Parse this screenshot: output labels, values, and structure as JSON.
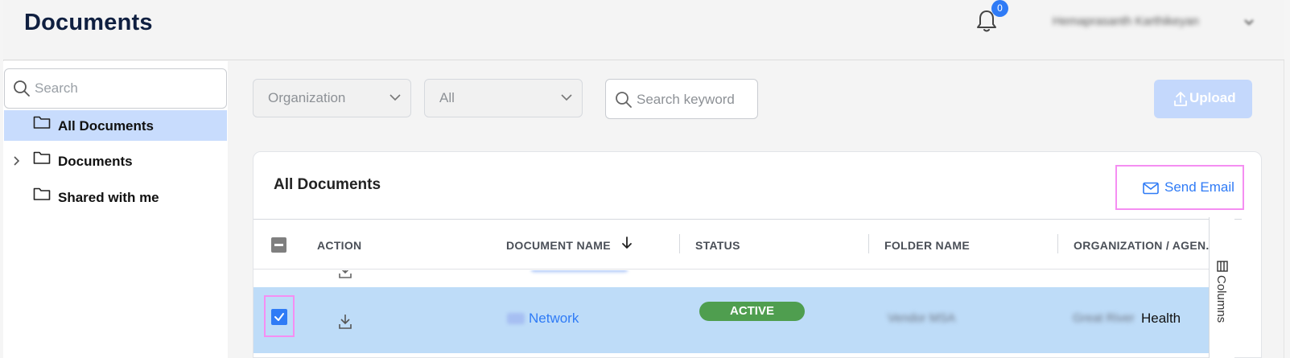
{
  "header": {
    "title": "Documents",
    "notification_count": "0",
    "user_name": "Hemaprasanth Karthikeyan"
  },
  "sidebar": {
    "search_placeholder": "Search",
    "items": [
      {
        "label": "All Documents",
        "selected": true,
        "expandable": false
      },
      {
        "label": "Documents",
        "selected": false,
        "expandable": true
      },
      {
        "label": "Shared with me",
        "selected": false,
        "expandable": false
      }
    ]
  },
  "filters": {
    "organization": "Organization",
    "status": "All",
    "keyword_placeholder": "Search keyword",
    "upload_label": "Upload"
  },
  "panel": {
    "title": "All Documents",
    "send_email_label": "Send Email",
    "columns_label": "Columns"
  },
  "table": {
    "headers": [
      "ACTION",
      "DOCUMENT NAME",
      "STATUS",
      "FOLDER NAME",
      "ORGANIZATION / AGEN..."
    ],
    "sort": {
      "column": "DOCUMENT NAME",
      "direction": "descending"
    },
    "rows": [
      {
        "selected": true,
        "document_name_redacted": "RN",
        "document_name": "Network",
        "status": "ACTIVE",
        "folder_name": "Vendor MSA",
        "organization_redacted": "Great River",
        "organization": "Health"
      }
    ]
  },
  "colors": {
    "accent": "#2f7bf6",
    "selected_row": "#bedcf8",
    "active_status": "#4f9e4f",
    "highlight_box": "#f58ef2"
  }
}
